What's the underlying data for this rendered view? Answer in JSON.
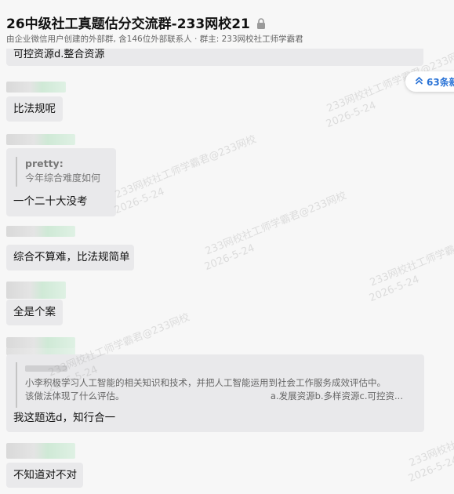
{
  "header": {
    "title": "26中级社工真题估分交流群-233网校21",
    "subtitle": "由企业微信用户创建的外部群, 含146位外部联系人 · 群主: 233网校社工师学霸君"
  },
  "new_messages_label": "63条新",
  "watermark_text": "233网校社工师学霸君@233网校",
  "watermark_date": "2026-5-24",
  "messages": [
    {
      "text": "可控资源d.整合资源"
    },
    {
      "text": "比法规呢"
    },
    {
      "quote_name": "pretty:",
      "quote_text": "今年综合难度如何",
      "text": "一个二十大没考"
    },
    {
      "text": "综合不算难，比法规简单"
    },
    {
      "text": "全是个案"
    },
    {
      "quote_line1": "小李积极学习人工智能的相关知识和技术，并把人工智能运用到社会工作服务成效评估中。",
      "quote_line2": "该做法体现了什么评估。",
      "quote_line2_right": "a.发展资源b.多样资源c.可控资...",
      "text": "我这题选d，知行合一"
    },
    {
      "text": "不知道对不对"
    }
  ]
}
